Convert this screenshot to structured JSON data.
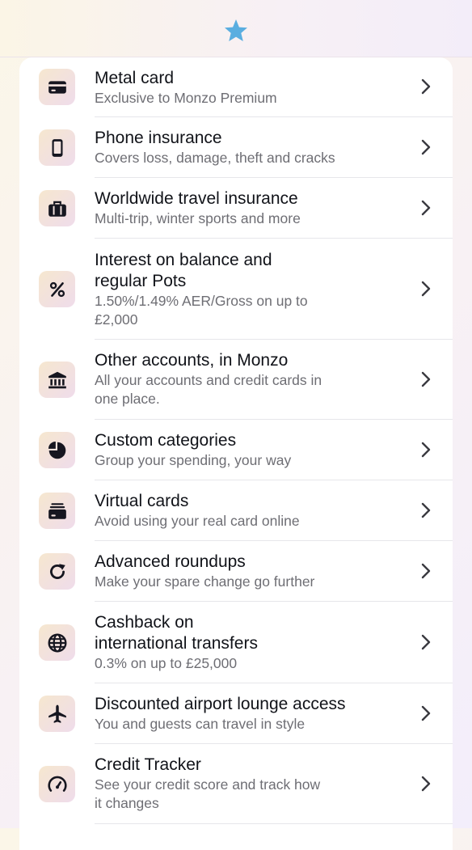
{
  "header": {
    "icon": "star-icon",
    "accent": "#5aaee0"
  },
  "items": [
    {
      "icon": "card-icon",
      "title": "Metal card",
      "subtitle": "Exclusive to Monzo Premium"
    },
    {
      "icon": "phone-icon",
      "title": "Phone insurance",
      "subtitle": "Covers loss, damage, theft and cracks"
    },
    {
      "icon": "suitcase-icon",
      "title": "Worldwide travel insurance",
      "subtitle": "Multi-trip, winter sports and more"
    },
    {
      "icon": "percent-icon",
      "title_lines": [
        "Interest on balance and",
        "regular Pots"
      ],
      "subtitle_lines": [
        "1.50%/1.49% AER/Gross on up to",
        "£2,000"
      ]
    },
    {
      "icon": "bank-icon",
      "title": "Other accounts, in Monzo",
      "subtitle_lines": [
        "All your accounts and credit cards in",
        "one place."
      ]
    },
    {
      "icon": "pie-chart-icon",
      "title": "Custom categories",
      "subtitle": "Group your spending, your way"
    },
    {
      "icon": "virtual-cards-icon",
      "title": "Virtual cards",
      "subtitle": "Avoid using your real card online"
    },
    {
      "icon": "refresh-icon",
      "title": "Advanced roundups",
      "subtitle": "Make your spare change go further"
    },
    {
      "icon": "globe-icon",
      "title_lines": [
        "Cashback on",
        "international transfers"
      ],
      "subtitle": "0.3% on up to £25,000"
    },
    {
      "icon": "airplane-icon",
      "title": "Discounted airport lounge access",
      "subtitle": "You and guests can travel in style"
    },
    {
      "icon": "gauge-icon",
      "title": "Credit Tracker",
      "subtitle_lines": [
        "See your credit score and track how",
        "it changes"
      ]
    }
  ]
}
